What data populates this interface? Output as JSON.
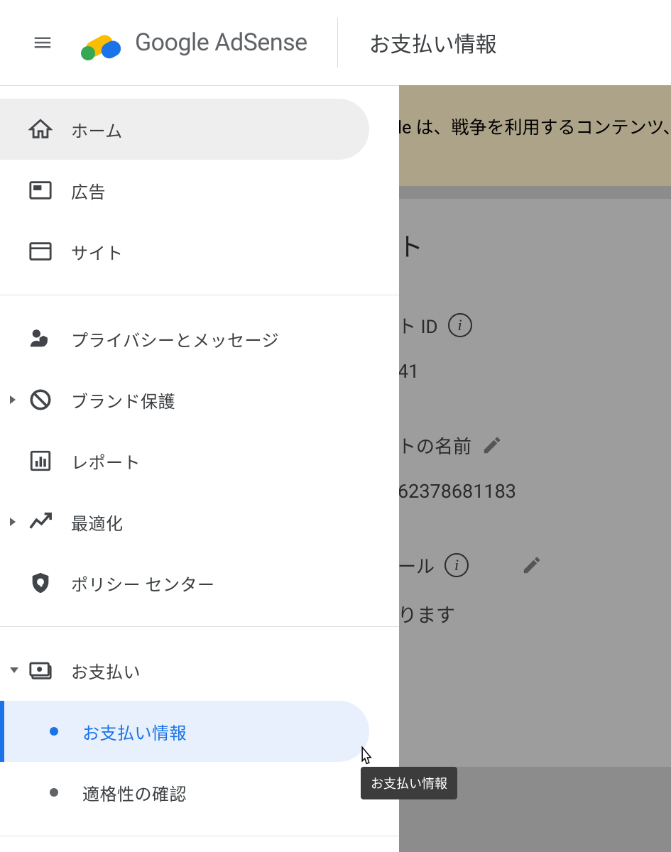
{
  "header": {
    "brand": "Google AdSense",
    "title": "お支払い情報"
  },
  "sidebar": {
    "home": "ホーム",
    "ads": "広告",
    "sites": "サイト",
    "privacy": "プライバシーとメッセージ",
    "brand_safety": "ブランド保護",
    "reports": "レポート",
    "optimization": "最適化",
    "policy_center": "ポリシー センター",
    "payments": "お支払い",
    "payments_info": "お支払い情報",
    "eligibility": "適格性の確認"
  },
  "content": {
    "banner_fragment": "le は、戦争を利用するコンテンツ、",
    "section_title_fragment": "ト",
    "id_label_fragment": "ト ID",
    "id_value_fragment": "41",
    "name_label_fragment": "トの名前",
    "name_value_fragment": "62378681183",
    "email_label_fragment": "ール",
    "email_value_fragment": "ります"
  },
  "tooltip": "お支払い情報",
  "icons": {
    "menu": "menu-icon",
    "home": "home-icon",
    "ads": "ads-icon",
    "sites": "sites-icon",
    "privacy": "privacy-icon",
    "block": "block-icon",
    "reports": "reports-icon",
    "optimization": "trend-icon",
    "policy": "shield-icon",
    "payments": "payments-icon",
    "info": "info-icon",
    "edit": "edit-icon"
  }
}
